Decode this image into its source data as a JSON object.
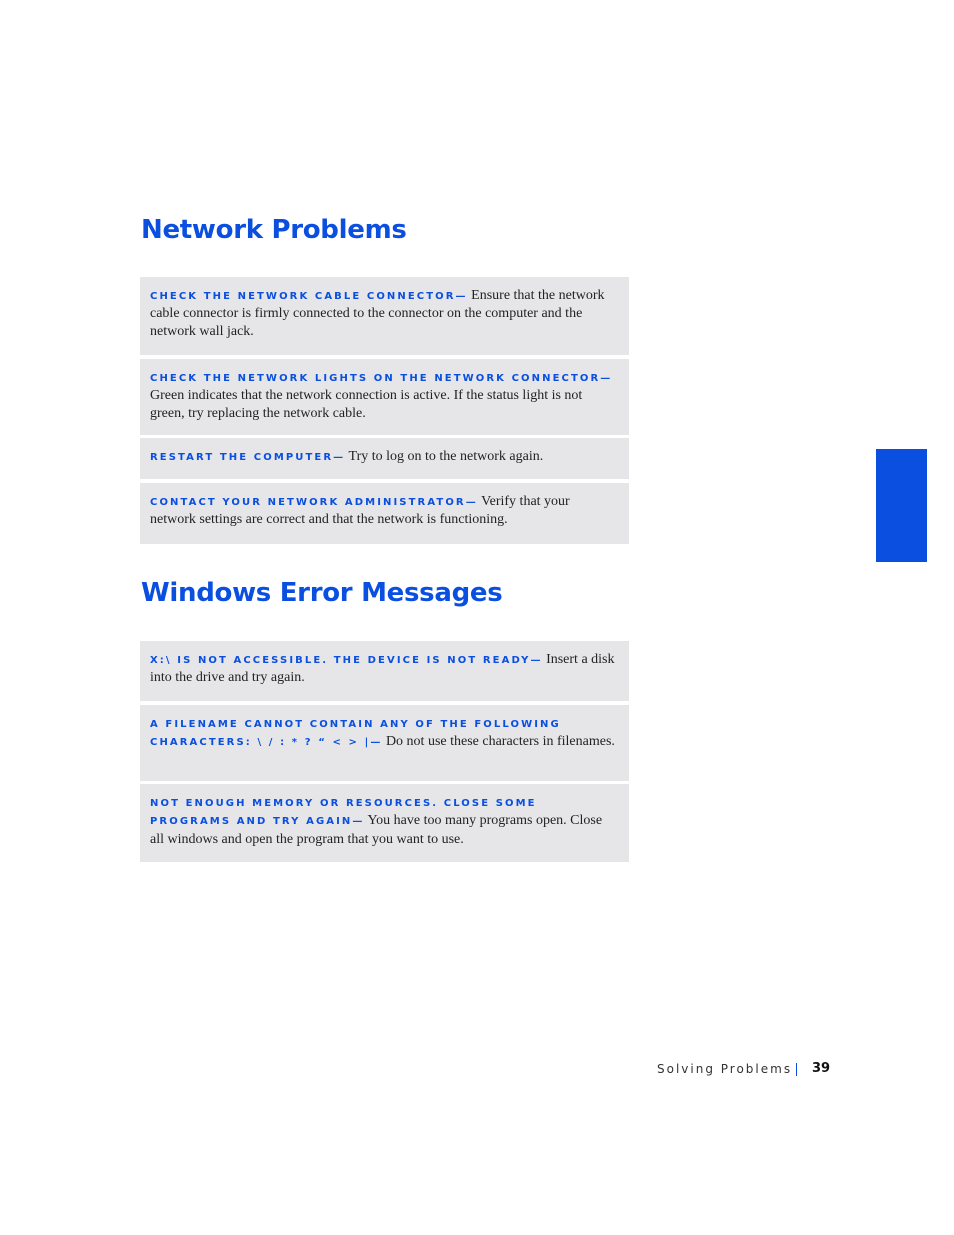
{
  "sections": [
    {
      "title": "Network Problems",
      "items": [
        {
          "lead": "Check the network cable connector—",
          "body": " Ensure that the network cable connector is firmly connected to the connector on the computer and the network wall jack."
        },
        {
          "lead": "Check the network lights on the network connector—",
          "body": " Green indicates that the network connection is active. If the status light is not green, try replacing the network cable."
        },
        {
          "lead": "Restart the computer—",
          "body": " Try to log on to the network again."
        },
        {
          "lead": "Contact your network administrator—",
          "body": " Verify that your network settings are correct and that the network is functioning."
        }
      ]
    },
    {
      "title": "Windows Error Messages",
      "items": [
        {
          "lead": "x:\\ is not accessible. The device is not ready—",
          "body": " Insert a disk into the drive and try again."
        },
        {
          "lead": "A filename cannot contain any of the following characters: \\ / : * ? “ < > |—",
          "body": " Do not use these characters in filenames."
        },
        {
          "lead": "Not enough memory or resources. Close some programs and try again—",
          "body": " You have too many programs open. Close all windows and open the program that you want to use."
        }
      ]
    }
  ],
  "footer": {
    "section": "Solving Problems",
    "page": "39"
  },
  "colors": {
    "accent": "#0a4fe0",
    "box": "#e6e6e8"
  }
}
